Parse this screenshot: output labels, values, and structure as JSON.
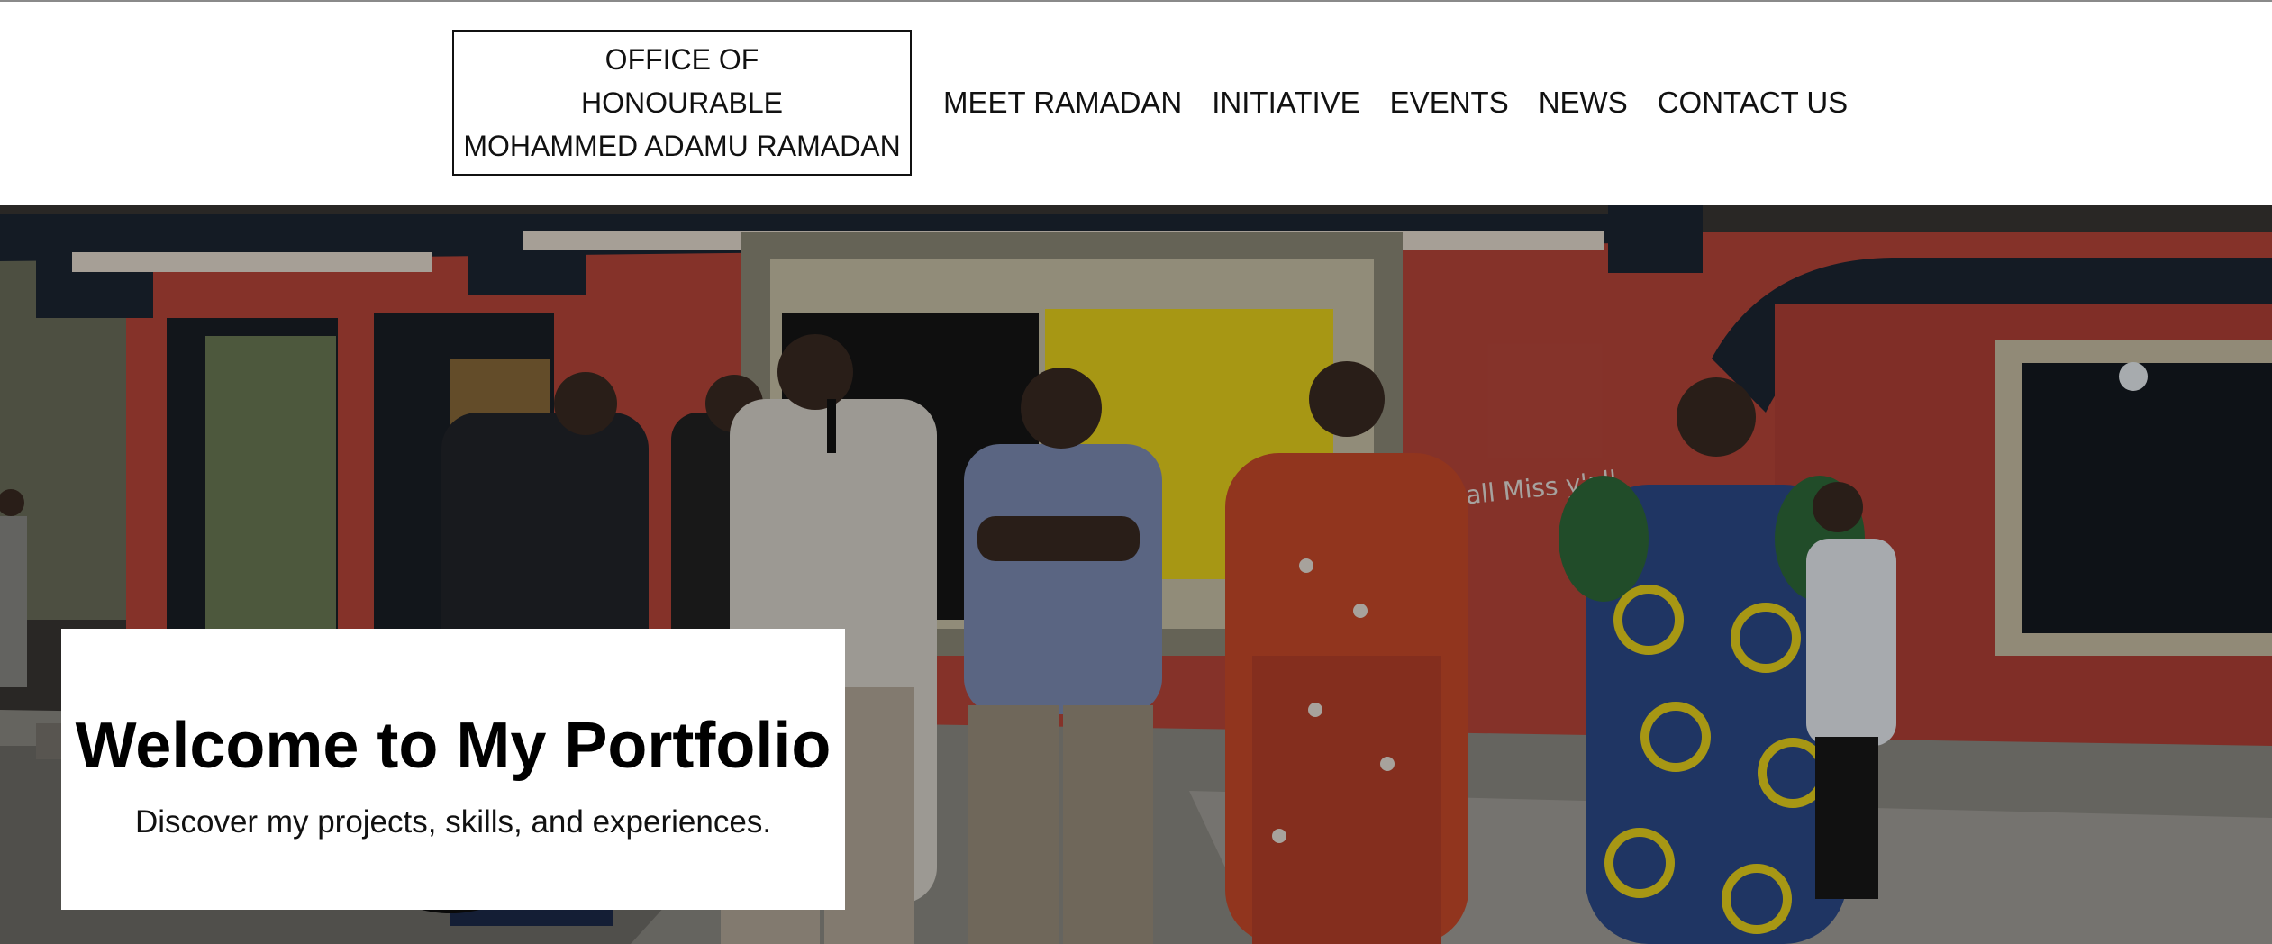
{
  "logo": {
    "line1": "OFFICE OF",
    "line2": "HONOURABLE",
    "line3": "MOHAMMED ADAMU RAMADAN"
  },
  "nav": {
    "items": [
      {
        "label": "MEET RAMADAN"
      },
      {
        "label": "INITIATIVE"
      },
      {
        "label": "EVENTS"
      },
      {
        "label": "NEWS"
      },
      {
        "label": "CONTACT US"
      }
    ]
  },
  "hero": {
    "title": "Welcome to My Portfolio",
    "subtitle": "Discover my projects, skills, and experiences.",
    "wall_writing": "chall Miss y'all"
  },
  "colors": {
    "wall": "#b9463a",
    "roof": "#1d2633",
    "window_yellow": "#e8d21c",
    "ground": "#8d8b84"
  }
}
